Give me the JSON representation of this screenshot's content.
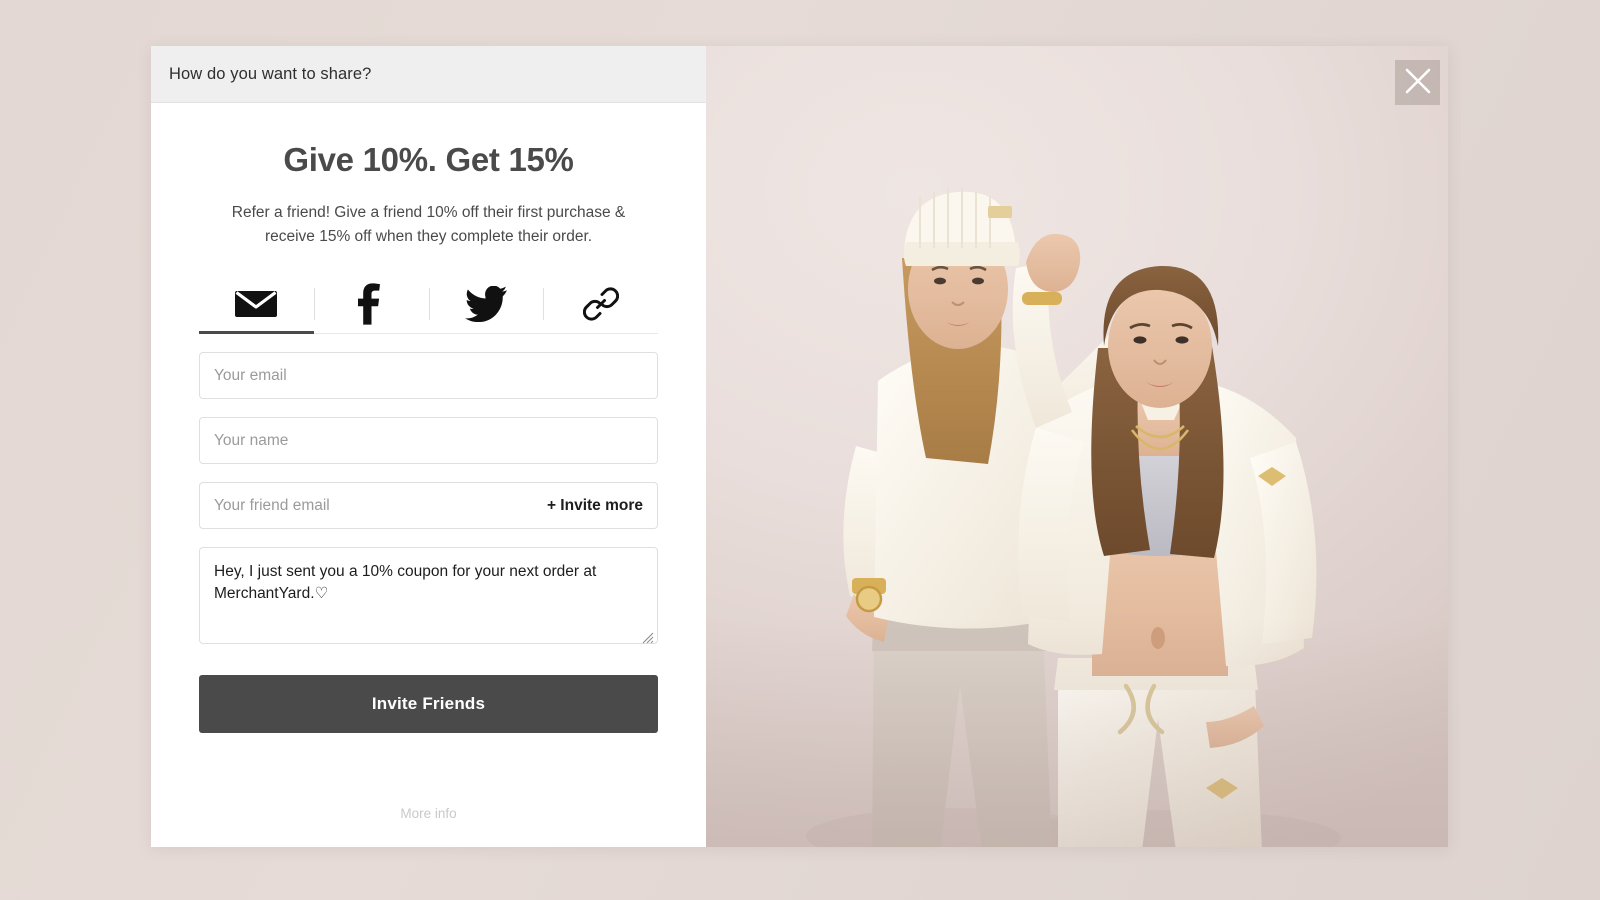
{
  "page": {
    "background_color": "#e3d8d3"
  },
  "modal": {
    "header": {
      "title": "How do you want to share?"
    },
    "offer": {
      "headline": "Give 10%. Get 15%",
      "description": "Refer a friend! Give a friend 10% off their first purchase & receive 15% off when they complete their order."
    },
    "share_tabs": [
      {
        "id": "email",
        "icon": "envelope-icon",
        "label": "Email",
        "active": true
      },
      {
        "id": "facebook",
        "icon": "facebook-icon",
        "label": "Facebook",
        "active": false
      },
      {
        "id": "twitter",
        "icon": "twitter-icon",
        "label": "Twitter",
        "active": false
      },
      {
        "id": "link",
        "icon": "link-icon",
        "label": "Copy link",
        "active": false
      }
    ],
    "form": {
      "your_email_placeholder": "Your email",
      "your_email_value": "",
      "your_name_placeholder": "Your name",
      "your_name_value": "",
      "friend_email_placeholder": "Your friend email",
      "friend_email_value": "",
      "invite_more_label": "+ Invite more",
      "message_value": "Hey, I just sent you a 10% coupon for your next order at MerchantYard.♡",
      "submit_label": "Invite Friends"
    },
    "footer": {
      "more_info_label": "More info"
    },
    "close_button": {
      "icon": "close-icon",
      "label": "Close"
    },
    "colors": {
      "header_bar": "#efefef",
      "button": "#4a4a4a",
      "heading_text": "#4a4a4a",
      "placeholder_text": "#9b9b9b",
      "more_info_text": "#c9c9c9",
      "photo_backdrop": "#e9dedb"
    },
    "photo": {
      "alt": "Two women wearing cream athleisure sweatsuits against a dusty pink backdrop"
    }
  }
}
